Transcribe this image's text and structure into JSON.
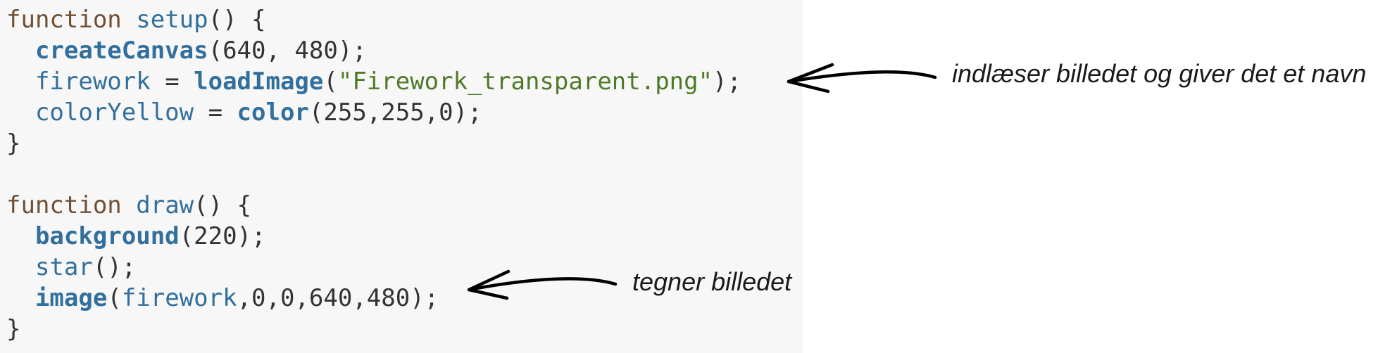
{
  "code": {
    "line1": {
      "kw": "function",
      "sp": " ",
      "name": "setup",
      "rest": "() {"
    },
    "line2": {
      "indent": "  ",
      "fn": "createCanvas",
      "rest": "(640, 480);"
    },
    "line3": {
      "indent": "  ",
      "var": "firework",
      "eq": " = ",
      "fn": "loadImage",
      "open": "(",
      "str": "\"Firework_transparent.png\"",
      "close": ");"
    },
    "line4": {
      "indent": "  ",
      "var": "colorYellow",
      "eq": " = ",
      "fn": "color",
      "rest": "(255,255,0);"
    },
    "line5": {
      "text": "}"
    },
    "line7": {
      "kw": "function",
      "sp": " ",
      "name": "draw",
      "rest": "() {"
    },
    "line8": {
      "indent": "  ",
      "fn": "background",
      "rest": "(220);"
    },
    "line9": {
      "indent": "  ",
      "fn": "star",
      "rest": "();"
    },
    "line10": {
      "indent": "  ",
      "fn": "image",
      "open": "(",
      "var": "firework",
      "rest": ",0,0,640,480);"
    },
    "line11": {
      "text": "}"
    }
  },
  "annotations": {
    "load_image_note": "indlæser billedet og giver det et navn",
    "draw_image_note": "tegner billedet"
  }
}
